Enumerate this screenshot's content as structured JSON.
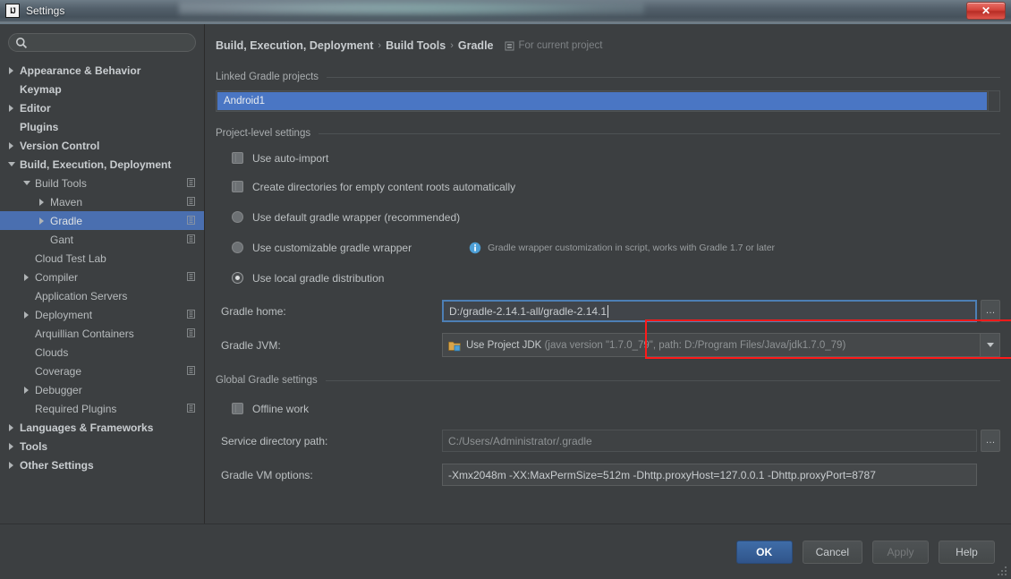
{
  "window": {
    "title": "Settings",
    "app_icon": "intellij-idea-icon",
    "close_label": "✕"
  },
  "sidebar": {
    "search": {
      "placeholder": "",
      "value": "",
      "icon": "search-icon"
    },
    "items": [
      {
        "label": "Appearance & Behavior",
        "arrow": "right",
        "indent": 0,
        "bold": true,
        "badge": false,
        "selected": false
      },
      {
        "label": "Keymap",
        "arrow": "none",
        "indent": 0,
        "bold": true,
        "badge": false,
        "selected": false
      },
      {
        "label": "Editor",
        "arrow": "right",
        "indent": 0,
        "bold": true,
        "badge": false,
        "selected": false
      },
      {
        "label": "Plugins",
        "arrow": "none",
        "indent": 0,
        "bold": true,
        "badge": false,
        "selected": false
      },
      {
        "label": "Version Control",
        "arrow": "right",
        "indent": 0,
        "bold": true,
        "badge": false,
        "selected": false
      },
      {
        "label": "Build, Execution, Deployment",
        "arrow": "down",
        "indent": 0,
        "bold": true,
        "badge": false,
        "selected": false
      },
      {
        "label": "Build Tools",
        "arrow": "down",
        "indent": 1,
        "bold": false,
        "badge": true,
        "selected": false
      },
      {
        "label": "Maven",
        "arrow": "right",
        "indent": 2,
        "bold": false,
        "badge": true,
        "selected": false
      },
      {
        "label": "Gradle",
        "arrow": "right",
        "indent": 2,
        "bold": false,
        "badge": true,
        "selected": true
      },
      {
        "label": "Gant",
        "arrow": "none",
        "indent": 2,
        "bold": false,
        "badge": true,
        "selected": false
      },
      {
        "label": "Cloud Test Lab",
        "arrow": "none",
        "indent": 1,
        "bold": false,
        "badge": false,
        "selected": false
      },
      {
        "label": "Compiler",
        "arrow": "right",
        "indent": 1,
        "bold": false,
        "badge": true,
        "selected": false
      },
      {
        "label": "Application Servers",
        "arrow": "none",
        "indent": 1,
        "bold": false,
        "badge": false,
        "selected": false
      },
      {
        "label": "Deployment",
        "arrow": "right",
        "indent": 1,
        "bold": false,
        "badge": true,
        "selected": false
      },
      {
        "label": "Arquillian Containers",
        "arrow": "none",
        "indent": 1,
        "bold": false,
        "badge": true,
        "selected": false
      },
      {
        "label": "Clouds",
        "arrow": "none",
        "indent": 1,
        "bold": false,
        "badge": false,
        "selected": false
      },
      {
        "label": "Coverage",
        "arrow": "none",
        "indent": 1,
        "bold": false,
        "badge": true,
        "selected": false
      },
      {
        "label": "Debugger",
        "arrow": "right",
        "indent": 1,
        "bold": false,
        "badge": false,
        "selected": false
      },
      {
        "label": "Required Plugins",
        "arrow": "none",
        "indent": 1,
        "bold": false,
        "badge": true,
        "selected": false
      },
      {
        "label": "Languages & Frameworks",
        "arrow": "right",
        "indent": 0,
        "bold": true,
        "badge": false,
        "selected": false
      },
      {
        "label": "Tools",
        "arrow": "right",
        "indent": 0,
        "bold": true,
        "badge": false,
        "selected": false
      },
      {
        "label": "Other Settings",
        "arrow": "right",
        "indent": 0,
        "bold": true,
        "badge": false,
        "selected": false
      }
    ]
  },
  "breadcrumb": {
    "part1": "Build, Execution, Deployment",
    "sep1": "›",
    "part2": "Build Tools",
    "sep2": "›",
    "part3": "Gradle",
    "scope_icon": "project-scope-icon",
    "scope_text": "For current project"
  },
  "main": {
    "linked_section_title": "Linked Gradle projects",
    "linked_projects": [
      "Android1"
    ],
    "project_section_title": "Project-level settings",
    "checkboxes": [
      {
        "label": "Use auto-import",
        "checked": false
      },
      {
        "label": "Create directories for empty content roots automatically",
        "checked": false
      }
    ],
    "radios": [
      {
        "label": "Use default gradle wrapper (recommended)",
        "selected": false
      },
      {
        "label": "Use customizable gradle wrapper",
        "selected": false
      },
      {
        "label": "Use local gradle distribution",
        "selected": true
      }
    ],
    "wrapper_hint": {
      "icon": "info-icon",
      "text": "Gradle wrapper customization in script, works with Gradle 1.7 or later"
    },
    "gradle_home": {
      "label": "Gradle home:",
      "value": "D:/gradle-2.14.1-all/gradle-2.14.1",
      "browse_label": "…",
      "focused": true
    },
    "gradle_jvm": {
      "label": "Gradle JVM:",
      "icon": "jdk-folder-icon",
      "value_primary": "Use Project JDK",
      "value_detail": "(java version \"1.7.0_79\", path: D:/Program Files/Java/jdk1.7.0_79)"
    },
    "global_section_title": "Global Gradle settings",
    "offline": {
      "label": "Offline work",
      "checked": false
    },
    "service_dir": {
      "label": "Service directory path:",
      "value": "C:/Users/Administrator/.gradle",
      "browse_label": "…"
    },
    "vm_options": {
      "label": "Gradle VM options:",
      "value": "-Xmx2048m -XX:MaxPermSize=512m -Dhttp.proxyHost=127.0.0.1 -Dhttp.proxyPort=8787"
    },
    "highlight_color": "#ff1a1a"
  },
  "footer": {
    "ok": "OK",
    "cancel": "Cancel",
    "apply": "Apply",
    "help": "Help"
  }
}
